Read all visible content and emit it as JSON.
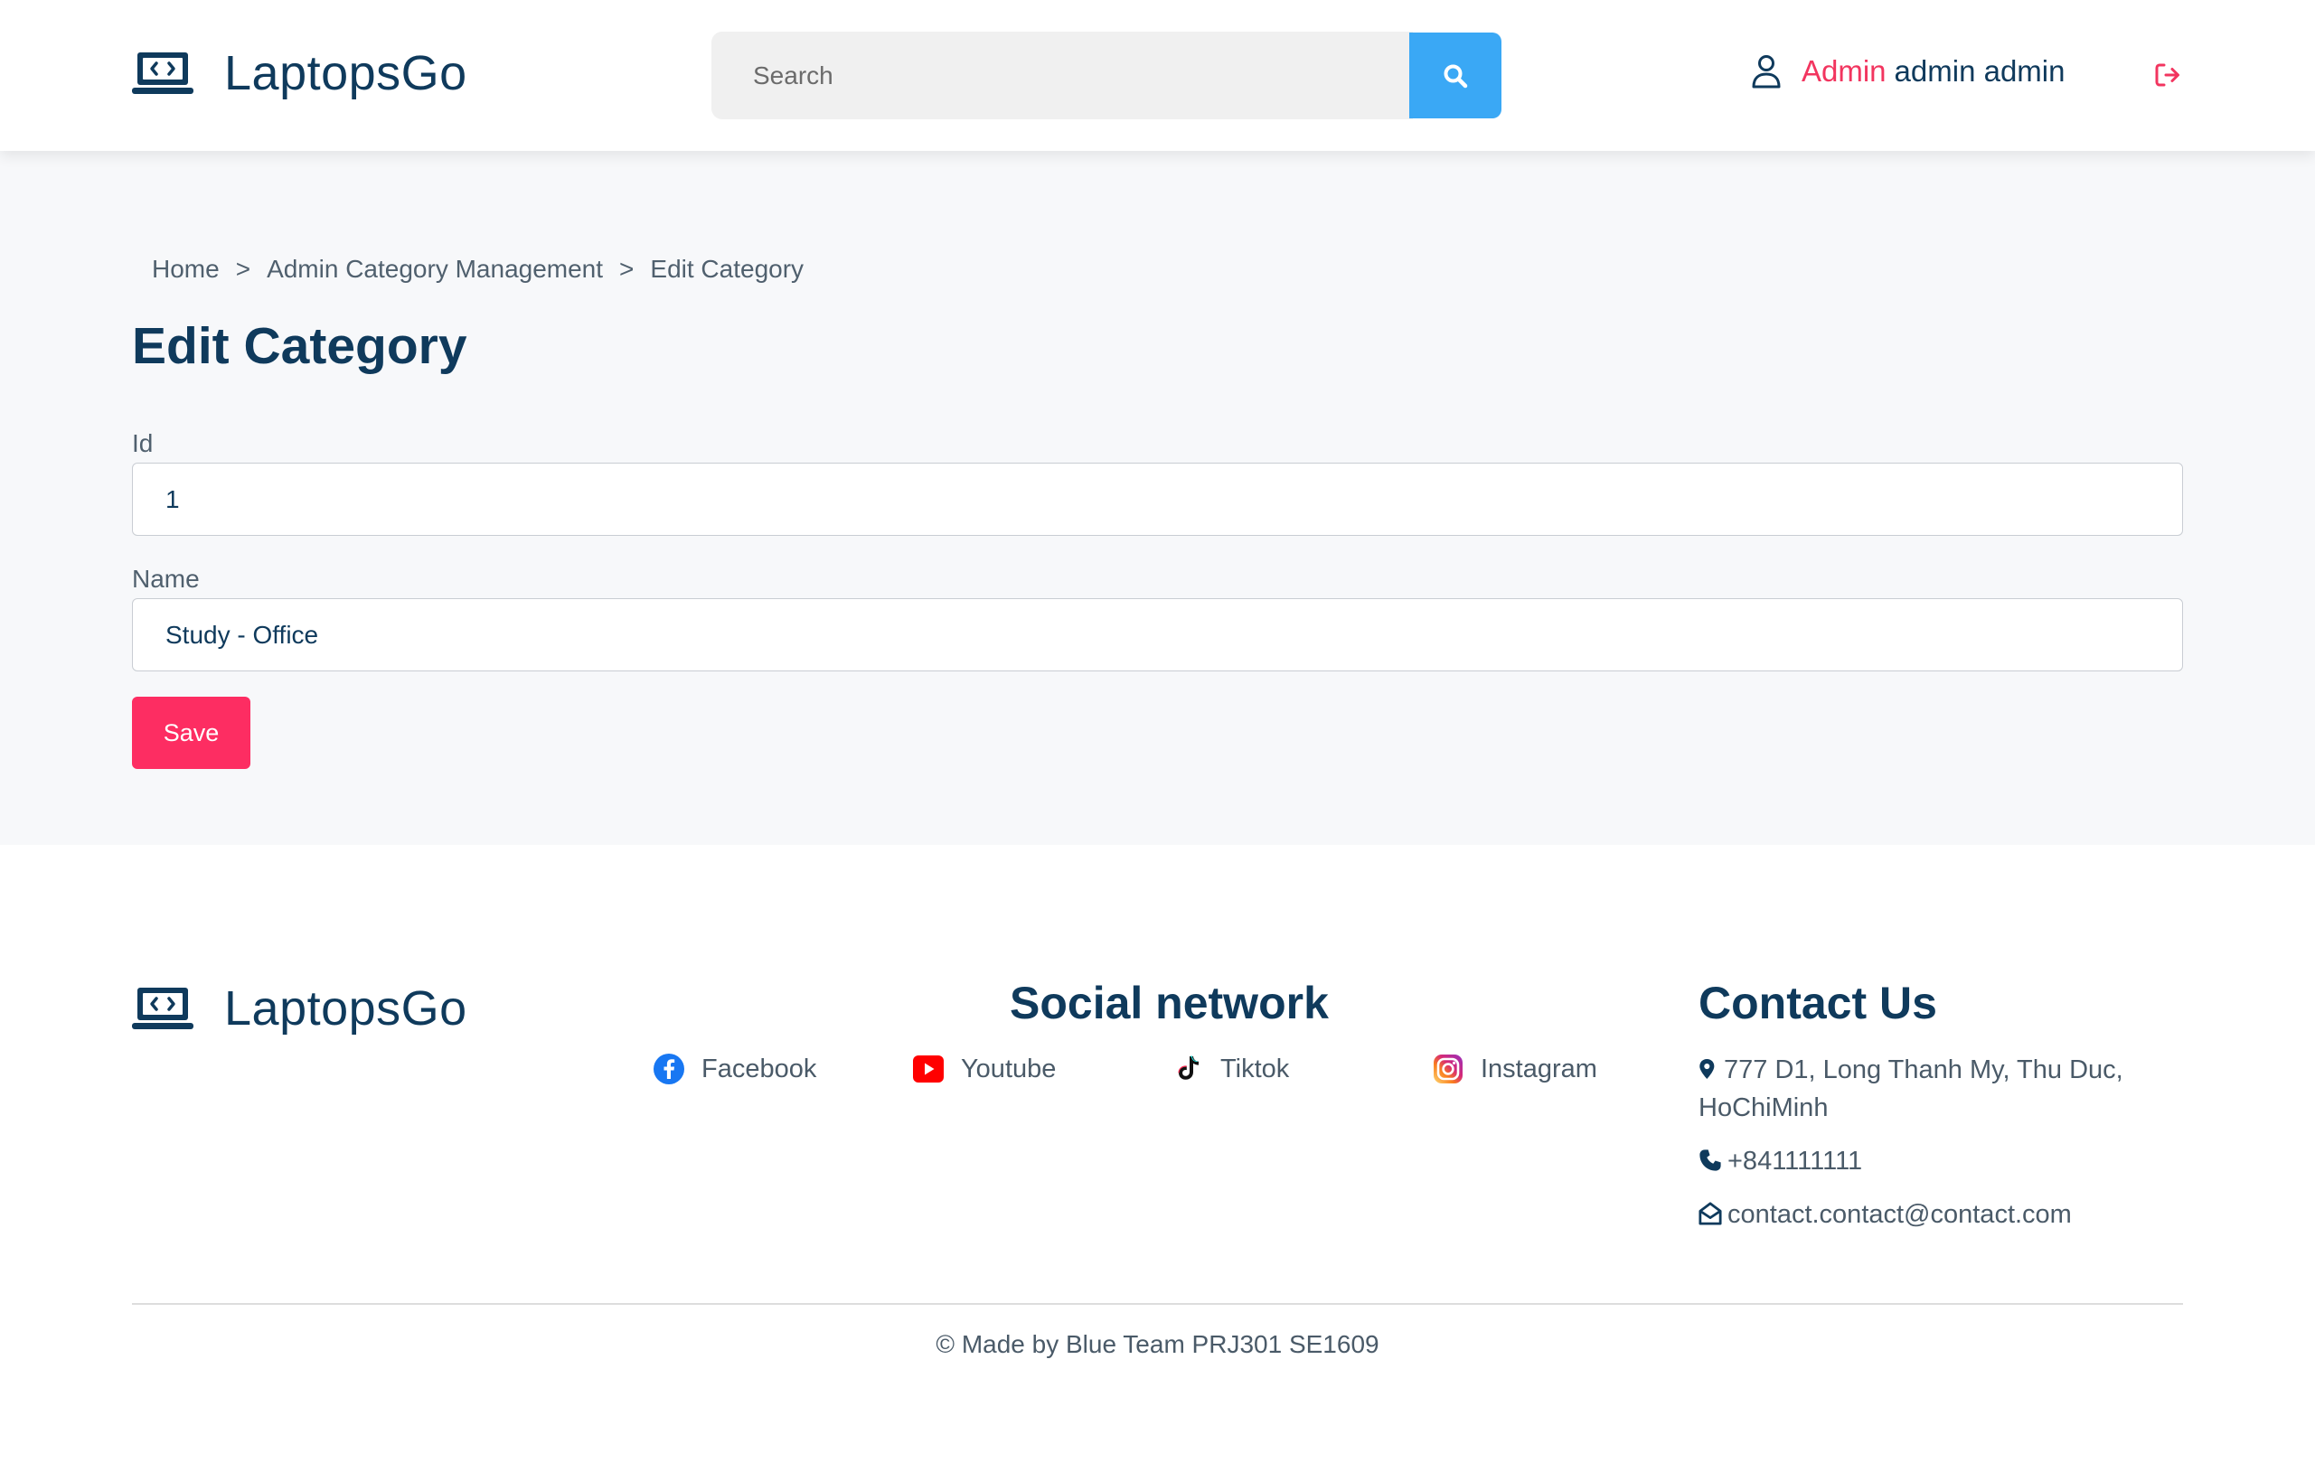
{
  "header": {
    "brand_name": "LaptopsGo",
    "search": {
      "placeholder": "Search",
      "value": ""
    },
    "user": {
      "role": "Admin",
      "name": "admin admin"
    }
  },
  "breadcrumb": [
    {
      "label": "Home"
    },
    {
      "label": "Admin Category Management"
    },
    {
      "label": "Edit Category"
    }
  ],
  "breadcrumb_separator": ">",
  "page_title": "Edit Category",
  "form": {
    "id_label": "Id",
    "id_value": "1",
    "name_label": "Name",
    "name_value": "Study - Office",
    "save_label": "Save"
  },
  "footer": {
    "brand_name": "LaptopsGo",
    "social_title": "Social network",
    "social": [
      {
        "label": "Facebook",
        "icon": "facebook-icon"
      },
      {
        "label": "Youtube",
        "icon": "youtube-icon"
      },
      {
        "label": "Tiktok",
        "icon": "tiktok-icon"
      },
      {
        "label": "Instagram",
        "icon": "instagram-icon"
      }
    ],
    "contact_title": "Contact Us",
    "address": "777 D1, Long Thanh My, Thu Duc, HoChiMinh",
    "phone": "+841111111",
    "email": "contact.contact@contact.com",
    "copyright": "© Made by Blue Team PRJ301 SE1609"
  },
  "colors": {
    "brand": "#0f3a5c",
    "accent": "#fd2d62",
    "search_button": "#3aa8f5",
    "page_background": "#f7f8fa"
  }
}
